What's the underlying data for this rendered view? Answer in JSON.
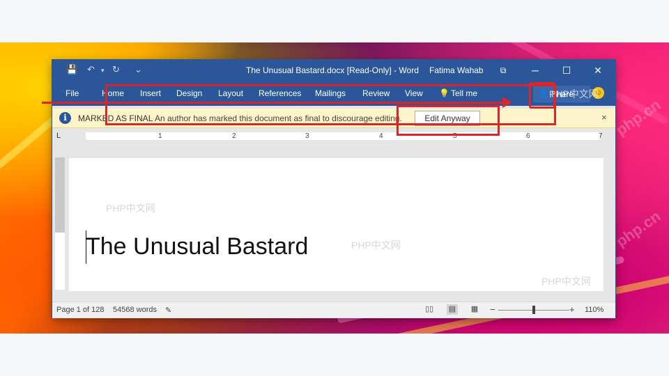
{
  "window": {
    "title": "The Unusual Bastard.docx [Read-Only]  -  Word",
    "user": "Fatima Wahab",
    "controls": {
      "restore": "⧉",
      "minimize": "─",
      "maximize": "☐",
      "close": "✕"
    }
  },
  "quick_access": {
    "save": "💾",
    "undo": "↶",
    "undo_menu": "▾",
    "redo": "↻",
    "customize": "⌄"
  },
  "ribbon": {
    "tabs": [
      "File",
      "Home",
      "Insert",
      "Design",
      "Layout",
      "References",
      "Mailings",
      "Review",
      "View"
    ],
    "tell_me": "Tell me",
    "share": "Share",
    "smiley": "☺"
  },
  "infobar": {
    "icon": "i",
    "title": "MARKED AS FINAL",
    "message": "An author has marked this document as final to discourage editing.",
    "button": "Edit Anyway",
    "close": "×"
  },
  "ruler": {
    "tab_stop": "L",
    "numbers": [
      "1",
      "2",
      "3",
      "4",
      "5",
      "6",
      "7"
    ]
  },
  "document": {
    "title": "The Unusual Bastard"
  },
  "statusbar": {
    "page": "Page 1 of 128",
    "words": "54568 words",
    "proofing_icon": "✎",
    "zoom_minus": "−",
    "zoom_plus": "+",
    "zoom_level": "110%"
  },
  "watermarks": [
    "PHP中文网",
    "PHP中文网",
    "PHP中文网",
    "PHP中文网"
  ],
  "brand_watermark": "php.cn",
  "colors": {
    "word_blue": "#2b579a",
    "infobar_yellow": "#fdf5c9",
    "annotation_red": "#d9262b"
  }
}
